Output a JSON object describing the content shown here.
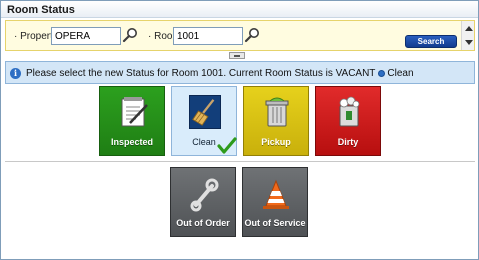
{
  "window": {
    "title": "Room Status"
  },
  "criteria": {
    "property_label": "· Property",
    "property_value": "OPERA",
    "room_label": "· Room",
    "room_value": "1001",
    "search_label": "Search"
  },
  "info": {
    "message": "Please select the new Status for Room 1001. Current Room Status is VACANT",
    "current_status": "Clean"
  },
  "tiles": [
    {
      "label": "Inspected",
      "color": "#2ca01e",
      "icon": "notepad-icon"
    },
    {
      "label": "Clean",
      "color": "#d9ecfb",
      "icon": "broom-icon",
      "selected": true
    },
    {
      "label": "Pickup",
      "color": "#e6d11c",
      "icon": "trash-can-icon"
    },
    {
      "label": "Dirty",
      "color": "#e12b2b",
      "icon": "full-trash-icon"
    },
    {
      "label": "Out of Order",
      "color": "#6f7275",
      "icon": "wrench-icon"
    },
    {
      "label": "Out of Service",
      "color": "#6f7275",
      "icon": "traffic-cone-icon"
    }
  ]
}
